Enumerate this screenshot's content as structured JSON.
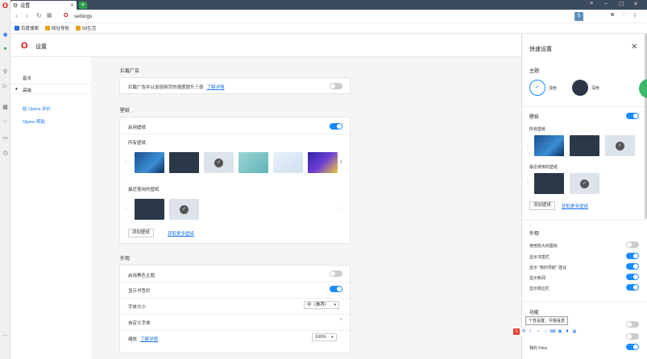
{
  "tab": {
    "title": "设置"
  },
  "address": {
    "url": "settings"
  },
  "bookmarks": [
    {
      "label": "百度搜索",
      "color": "#2b6fd6"
    },
    {
      "label": "网址导航",
      "color": "#e8a21a"
    },
    {
      "label": "58生活",
      "color": "#e8a21a"
    }
  ],
  "header": {
    "title": "设置"
  },
  "left_nav": {
    "basic": "基本",
    "advanced": "高级",
    "links": [
      "给 Opera 评价",
      "Opera 帮助"
    ]
  },
  "ads": {
    "section": "拦截广告",
    "row_text": "拦截广告并以加倍网页的速度提升三倍",
    "link": "了解详情",
    "enabled": false
  },
  "wallpaper": {
    "section": "壁纸",
    "enable_label": "启用壁纸",
    "enabled": true,
    "all_label": "所有壁纸",
    "recent_label": "最近使用的壁纸",
    "add_button": "添加壁纸",
    "more_link": "获取更多壁纸"
  },
  "appearance": {
    "section": "外观",
    "dark_theme": {
      "label": "启用黑色主题",
      "enabled": false
    },
    "bookmarks_bar": {
      "label": "显示书签栏",
      "enabled": true
    },
    "font_size": {
      "label": "字体大小",
      "value": "中（推荐）"
    },
    "custom_fonts": {
      "label": "自定义字体"
    },
    "zoom": {
      "label": "缩放",
      "link": "了解详情",
      "value": "100%"
    }
  },
  "quick": {
    "title": "快速设置",
    "theme_section": "主题",
    "light": "浅色",
    "dark": "深色",
    "wallpaper_section": "壁纸",
    "wallpaper_enabled": true,
    "all_wallpapers": "所有壁纸",
    "recent_wallpapers": "最近使用的壁纸",
    "add_button": "添加壁纸",
    "more_link": "获取更多壁纸",
    "appearance_section": "外观",
    "appearance_rows": [
      {
        "label": "使用较大的图标",
        "enabled": false
      },
      {
        "label": "显示书签栏",
        "enabled": true
      },
      {
        "label": "显示 “我的导航” 建议",
        "enabled": true
      },
      {
        "label": "显示新闻",
        "enabled": true
      },
      {
        "label": "显示侧边栏",
        "enabled": true
      }
    ],
    "features_section": "功能",
    "features_rows": [
      {
        "label": "",
        "enabled": false
      },
      {
        "label": "",
        "enabled": false
      },
      {
        "label": "我的 Flow",
        "enabled": true
      }
    ]
  },
  "tooltip": "个性设置，尽我喜爱",
  "colors": {
    "accent": "#1a8cff",
    "opera_red": "#d00000",
    "tab_bar": "#3b4a5c"
  }
}
